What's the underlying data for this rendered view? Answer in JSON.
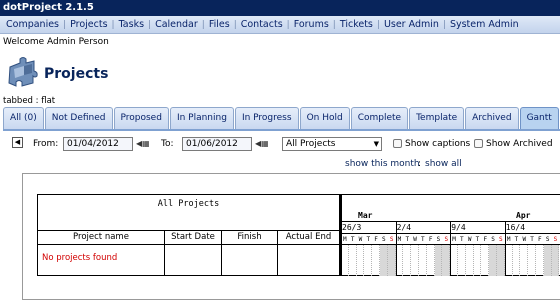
{
  "app": {
    "title": "dotProject 2.1.5"
  },
  "nav": [
    "Companies",
    "Projects",
    "Tasks",
    "Calendar",
    "Files",
    "Contacts",
    "Forums",
    "Tickets",
    "User Admin",
    "System Admin"
  ],
  "welcome": "Welcome Admin Person",
  "page_title": "Projects",
  "tab_mode": "tabbed : flat",
  "tabs": [
    "All (0)",
    "Not Defined",
    "Proposed",
    "In Planning",
    "In Progress",
    "On Hold",
    "Complete",
    "Template",
    "Archived",
    "Gantt"
  ],
  "active_tab": "Gantt",
  "filters": {
    "from_label": "From:",
    "from_value": "01/04/2012",
    "to_label": "To:",
    "to_value": "01/06/2012",
    "project_select": "All Projects",
    "show_captions": "Show captions",
    "show_archived": "Show Archived",
    "show_this_month": "show this month",
    "separator": ":",
    "show_all": "show all"
  },
  "gantt": {
    "header": "All Projects",
    "columns": [
      "Project name",
      "Start Date",
      "Finish",
      "Actual End"
    ],
    "empty_message": "No projects found",
    "months": [
      "Mar",
      "Apr"
    ],
    "weeks": [
      "26/3",
      "2/4",
      "9/4",
      "16/4"
    ],
    "day_letters": [
      "M",
      "T",
      "W",
      "T",
      "F",
      "S",
      "S"
    ]
  },
  "colors": {
    "titlebar": "#08245b",
    "tab_active": "#b8d3f0",
    "weekend": "#d8d8d8",
    "sunday_letter": "#d20000",
    "empty_message": "#d20000"
  }
}
